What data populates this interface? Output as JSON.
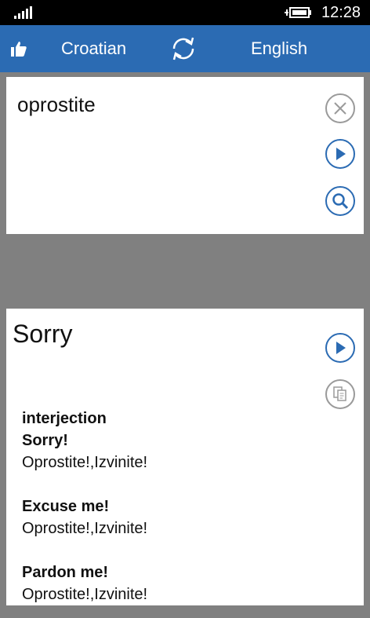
{
  "status_bar": {
    "time": "12:28",
    "icons": [
      "signal-icon",
      "battery-icon"
    ]
  },
  "header": {
    "source_language": "Croatian",
    "target_language": "English",
    "icons": [
      "like-icon",
      "swap-languages-icon"
    ]
  },
  "input": {
    "text": "oprostite",
    "icons": [
      "clear-icon",
      "play-icon",
      "search-icon"
    ]
  },
  "output": {
    "word": "Sorry",
    "icons": [
      "play-icon",
      "copy-icon"
    ],
    "part_of_speech": "interjection",
    "entries": [
      {
        "head": "Sorry!",
        "translation": "Oprostite!,Izvinite!"
      },
      {
        "head": "Excuse me!",
        "translation": "Oprostite!,Izvinite!"
      },
      {
        "head": "Pardon me!",
        "translation": "Oprostite!,Izvinite!"
      }
    ]
  },
  "colors": {
    "accent": "#2b6bb3",
    "background": "#808080",
    "panel": "#ffffff",
    "status_bar": "#000000"
  }
}
